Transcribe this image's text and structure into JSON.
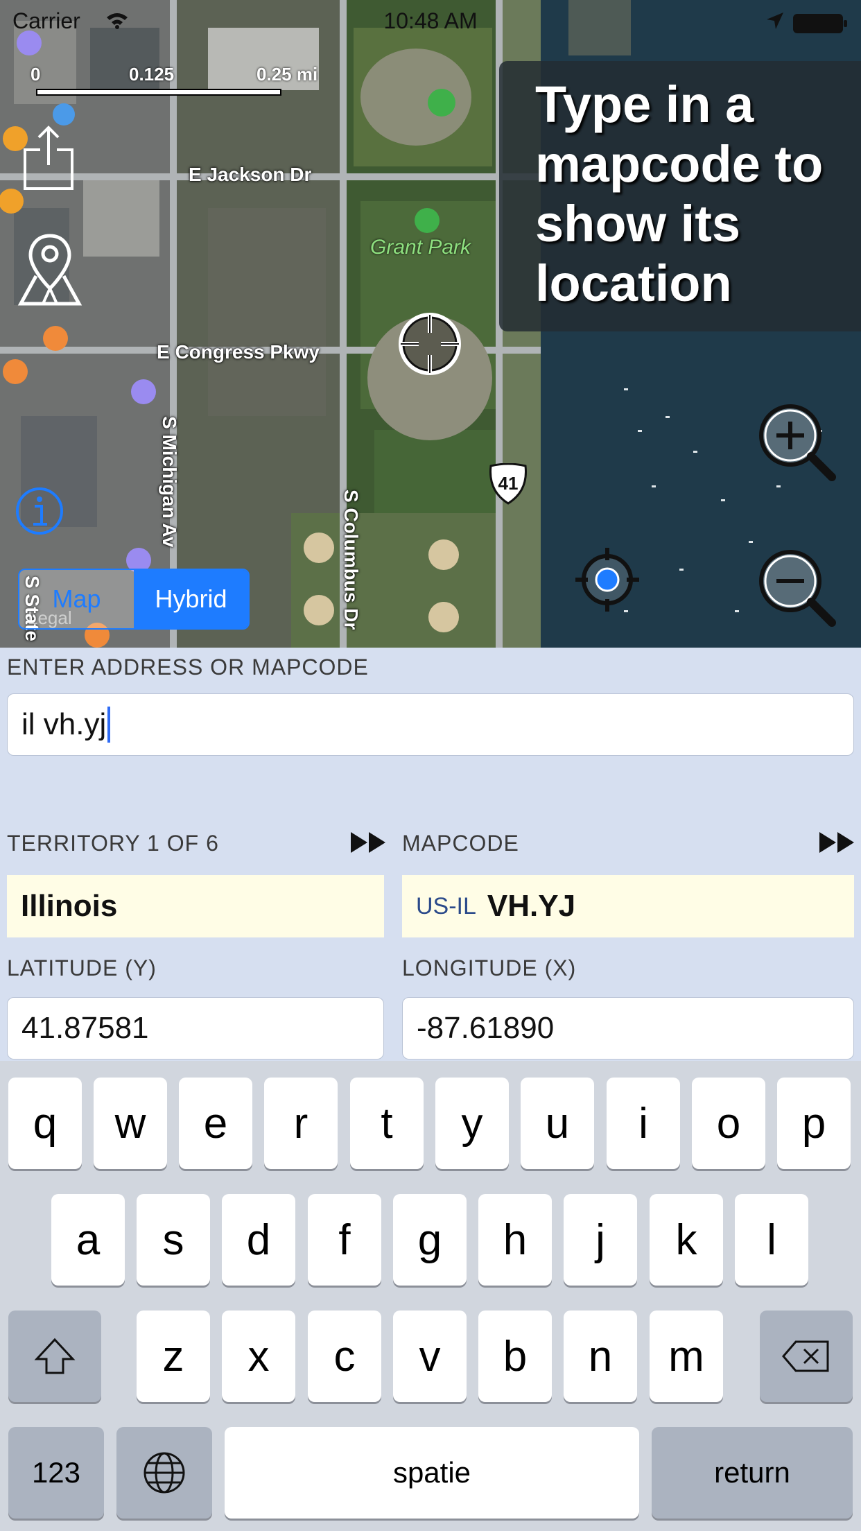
{
  "status_bar": {
    "carrier": "Carrier",
    "time": "10:48 AM"
  },
  "map": {
    "scale": {
      "start": "0",
      "mid": "0.125",
      "end": "0.25 mi"
    },
    "streets": {
      "jackson": "E Jackson Dr",
      "congress": "E Congress Pkwy",
      "michigan": "S Michigan Av",
      "columbus": "S Columbus Dr",
      "state": "S State"
    },
    "park_label": "Grant Park",
    "highway_shield": "41",
    "legal": "Legal",
    "overlay_text": "Type in a mapcode to show its location",
    "map_type": {
      "options": [
        "Map",
        "Hybrid"
      ],
      "selected": "Hybrid"
    },
    "icons": [
      "share-icon",
      "map-pin-icon",
      "info-icon",
      "crosshair-icon",
      "zoom-in-icon",
      "zoom-out-icon",
      "current-location-icon"
    ]
  },
  "form": {
    "address_label": "ENTER ADDRESS OR MAPCODE",
    "address_value": "il vh.yj",
    "territory_label": "TERRITORY 1 OF 6",
    "territory_value": "Illinois",
    "mapcode_label": "MAPCODE",
    "mapcode_prefix": "US-IL",
    "mapcode_value": "VH.YJ",
    "latitude_label": "LATITUDE (Y)",
    "latitude_value": "41.87581",
    "longitude_label": "LONGITUDE (X)",
    "longitude_value": "-87.61890"
  },
  "keyboard": {
    "row1": [
      "q",
      "w",
      "e",
      "r",
      "t",
      "y",
      "u",
      "i",
      "o",
      "p"
    ],
    "row2": [
      "a",
      "s",
      "d",
      "f",
      "g",
      "h",
      "j",
      "k",
      "l"
    ],
    "row3": [
      "z",
      "x",
      "c",
      "v",
      "b",
      "n",
      "m"
    ],
    "numbers_label": "123",
    "space_label": "spatie",
    "return_label": "return"
  },
  "colors": {
    "accent": "#1e7cff",
    "form_bg": "#d6dff0",
    "highlight_field": "#fffde6",
    "mapcode_prefix": "#2b4a8a"
  }
}
